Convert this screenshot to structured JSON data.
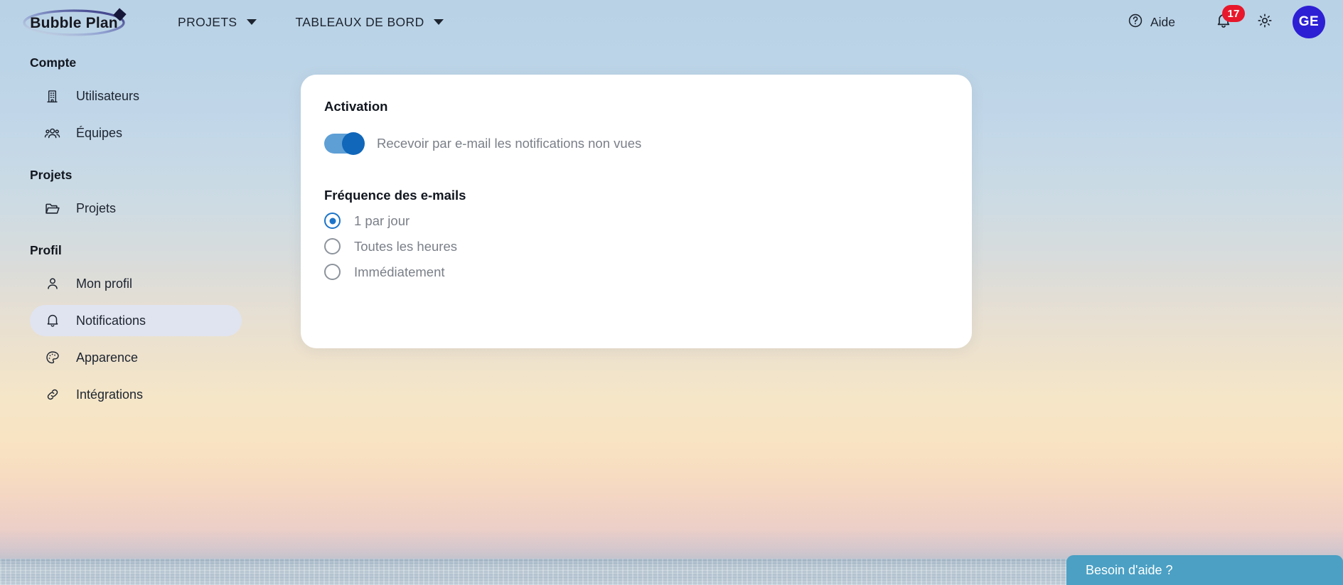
{
  "app": {
    "logo_text": "Bubble Plan",
    "brand_color": "#2d1fd4"
  },
  "header": {
    "nav": [
      {
        "label": "PROJETS",
        "icon": "chevron-down-icon"
      },
      {
        "label": "TABLEAUX DE BORD",
        "icon": "chevron-down-icon"
      }
    ],
    "help_label": "Aide",
    "help_icon": "question-circle-icon",
    "notifications": {
      "icon": "bell-icon",
      "badge_count": "17",
      "badge_color": "#e8172b"
    },
    "settings_icon": "gear-icon",
    "avatar": {
      "initials": "GE",
      "color": "#2d1fd4"
    }
  },
  "sidebar": {
    "groups": [
      {
        "title": "Compte",
        "items": [
          {
            "label": "Utilisateurs",
            "icon": "building-icon",
            "active": false
          },
          {
            "label": "Équipes",
            "icon": "users-icon",
            "active": false
          }
        ]
      },
      {
        "title": "Projets",
        "items": [
          {
            "label": "Projets",
            "icon": "folder-open-icon",
            "active": false
          }
        ]
      },
      {
        "title": "Profil",
        "items": [
          {
            "label": "Mon profil",
            "icon": "user-icon",
            "active": false
          },
          {
            "label": "Notifications",
            "icon": "bell-icon",
            "active": true
          },
          {
            "label": "Apparence",
            "icon": "palette-icon",
            "active": false
          },
          {
            "label": "Intégrations",
            "icon": "link-icon",
            "active": false
          }
        ]
      }
    ]
  },
  "card": {
    "activation": {
      "title": "Activation",
      "toggle_label": "Recevoir par e-mail les notifications non vues",
      "toggle_on": true,
      "toggle_track_color": "#5e9fd6",
      "toggle_knob_color": "#1167b9"
    },
    "frequency": {
      "title": "Fréquence des e-mails",
      "selected": "1 par jour",
      "accent_color": "#1b74c9",
      "options": [
        {
          "label": "1 par jour",
          "checked": true
        },
        {
          "label": "Toutes les heures",
          "checked": false
        },
        {
          "label": "Immédiatement",
          "checked": false
        }
      ]
    }
  },
  "help_widget": {
    "label": "Besoin d'aide ?",
    "color": "#4ba0c4"
  }
}
